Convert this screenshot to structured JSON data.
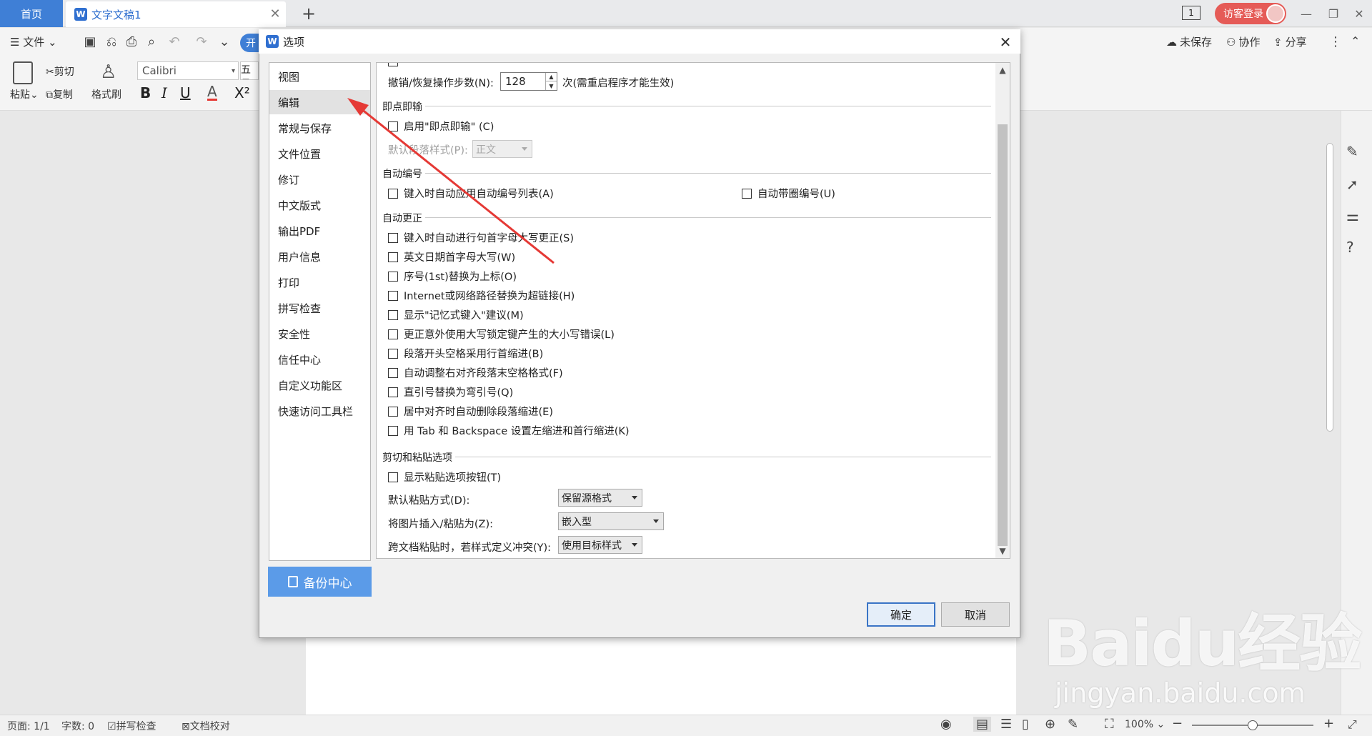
{
  "tabs": {
    "home": "首页",
    "doc": "文字文稿1"
  },
  "titlebar": {
    "login": "访客登录",
    "page_indicator": "1"
  },
  "menu": {
    "file": "文件",
    "save_state": "未保存",
    "collab": "协作",
    "share": "分享"
  },
  "ribbon": {
    "paste": "粘贴",
    "cut": "剪切",
    "copy": "复制",
    "format_painter": "格式刷",
    "font_name": "Calibri",
    "font_size": "五号",
    "start_tab_partial": "开"
  },
  "dialog": {
    "title": "选项",
    "nav": [
      "视图",
      "编辑",
      "常规与保存",
      "文件位置",
      "修订",
      "中文版式",
      "输出PDF",
      "用户信息",
      "打印",
      "拼写检查",
      "安全性",
      "信任中心",
      "自定义功能区",
      "快速访问工具栏"
    ],
    "selected_nav": "编辑",
    "backup": "备份中心",
    "undo_label": "撤销/恢复操作步数(N):",
    "undo_value": "128",
    "undo_suffix": "次(需重启程序才能生效)",
    "sections": {
      "click_type": "即点即输",
      "auto_number": "自动编号",
      "auto_correct": "自动更正",
      "cut_paste": "剪切和粘贴选项"
    },
    "click_type": {
      "enable": "启用\"即点即输\" (C)",
      "default_style_label": "默认段落样式(P):",
      "default_style_value": "正文"
    },
    "auto_number": {
      "auto_list": "键入时自动应用自动编号列表(A)",
      "auto_circle": "自动带圈编号(U)"
    },
    "auto_correct": [
      "键入时自动进行句首字母大写更正(S)",
      "英文日期首字母大写(W)",
      "序号(1st)替换为上标(O)",
      "Internet或网络路径替换为超链接(H)",
      "显示\"记忆式键入\"建议(M)",
      "更正意外使用大写锁定键产生的大小写错误(L)",
      "段落开头空格采用行首缩进(B)",
      "自动调整右对齐段落末空格格式(F)",
      "直引号替换为弯引号(Q)",
      "居中对齐时自动删除段落缩进(E)",
      "用 Tab 和 Backspace 设置左缩进和首行缩进(K)"
    ],
    "cut_paste": {
      "show_btn": "显示粘贴选项按钮(T)",
      "default_paste_label": "默认粘贴方式(D):",
      "default_paste_value": "保留源格式",
      "picture_label": "将图片插入/粘贴为(Z):",
      "picture_value": "嵌入型",
      "cross_doc_label": "跨文档粘贴时，若样式定义冲突(Y):",
      "cross_doc_value": "使用目标样式"
    },
    "ok": "确定",
    "cancel": "取消"
  },
  "status": {
    "page": "页面: 1/1",
    "words": "字数: 0",
    "spell": "拼写检查",
    "proof": "文档校对",
    "zoom": "100%"
  },
  "watermark": {
    "brand": "Baidu经验",
    "url": "jingyan.baidu.com"
  },
  "colors": {
    "accent": "#3f7fd6",
    "login": "#e55b57",
    "arrow": "#e53935",
    "backup": "#5b9be8"
  }
}
